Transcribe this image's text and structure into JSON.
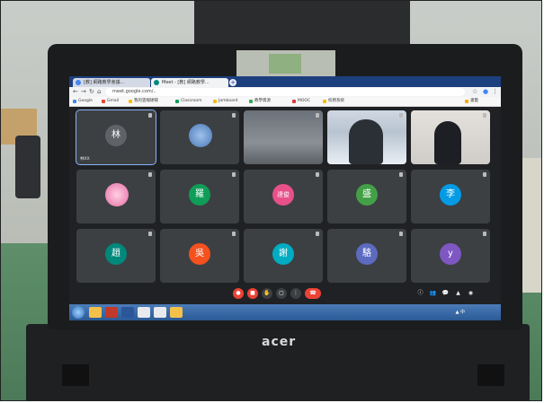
{
  "photo": {
    "brand_logo": "acer"
  },
  "browser": {
    "tabs": [
      {
        "label": "[教] 網路教學會議...",
        "color": "#4285f4"
      },
      {
        "label": "Meet - [教] 網路教學...",
        "color": "#00897b"
      }
    ],
    "new_tab_symbol": "+",
    "url": "meet.google.com/..",
    "bookmarks": [
      "Google",
      "Gmail",
      "我的雲端硬碟",
      "Classroom",
      "Jamboard",
      "教學資源",
      "MOOC",
      "校務系統",
      "書籤"
    ]
  },
  "meet": {
    "participants": [
      {
        "name": "林XX",
        "initial": "林",
        "color": "#5f6368",
        "active": true
      },
      {
        "name": "",
        "initial": "",
        "color": "#6d9bd1",
        "video": "pattern"
      },
      {
        "name": "",
        "initial": "",
        "color": "#8a8f96",
        "video": "room"
      },
      {
        "name": "",
        "initial": "",
        "color": "#c9d3dd",
        "video": "person"
      },
      {
        "name": "",
        "initial": "",
        "color": "#d7d3cf",
        "video": "person2"
      },
      {
        "name": "",
        "initial": "",
        "color": "#e56aa4",
        "video": "avatar"
      },
      {
        "name": "",
        "initial": "羅",
        "color": "#0f9d58"
      },
      {
        "name": "",
        "initial": "達俊",
        "color": "#e8508a"
      },
      {
        "name": "",
        "initial": "盛",
        "color": "#43a047"
      },
      {
        "name": "",
        "initial": "李",
        "color": "#039be5"
      },
      {
        "name": "",
        "initial": "趙",
        "color": "#00897b"
      },
      {
        "name": "",
        "initial": "吳",
        "color": "#f4511e"
      },
      {
        "name": "",
        "initial": "謝",
        "color": "#00acc1"
      },
      {
        "name": "",
        "initial": "駱",
        "color": "#5c6bc0"
      },
      {
        "name": "",
        "initial": "y",
        "color": "#7e57c2"
      }
    ],
    "meeting_info": "",
    "controls": {
      "mic": "mic-off-icon",
      "camera": "camera-off-icon",
      "raise_hand": "✋",
      "present": "▢",
      "more": "⋮",
      "hang_up": "☎"
    },
    "right_controls": [
      "ⓘ",
      "👥",
      "💬",
      "▲",
      "◉"
    ]
  },
  "taskbar": {
    "clock_time": "",
    "clock_date": "",
    "tray": "▲ 中"
  }
}
